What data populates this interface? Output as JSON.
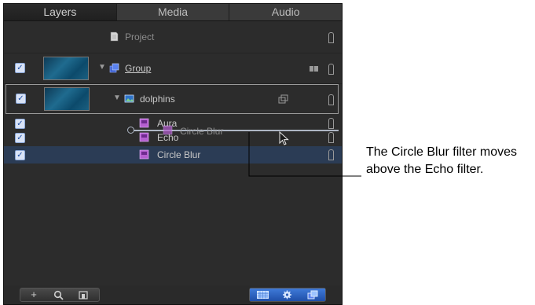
{
  "tabs": [
    "Layers",
    "Media",
    "Audio"
  ],
  "project": {
    "label": "Project"
  },
  "layers": {
    "group": {
      "label": "Group"
    },
    "dolphins": {
      "label": "dolphins"
    },
    "filters": [
      {
        "label": "Aura",
        "checked": true
      },
      {
        "label": "Echo",
        "checked": true
      },
      {
        "label": "Circle Blur",
        "checked": true,
        "selected": true
      }
    ]
  },
  "drag": {
    "label": "Circle Blur"
  },
  "bottom": {
    "left_buttons": [
      "+",
      "search-icon",
      "export-icon"
    ],
    "right_buttons": [
      "grid-icon",
      "gear-icon",
      "layers-icon"
    ]
  },
  "annotation": {
    "line1": "The Circle Blur filter moves",
    "line2": "above the Echo filter."
  },
  "colors": {
    "panel": "#2c2c2c",
    "selected_row": "#2b3c55",
    "accent": "#3f7ad8"
  }
}
